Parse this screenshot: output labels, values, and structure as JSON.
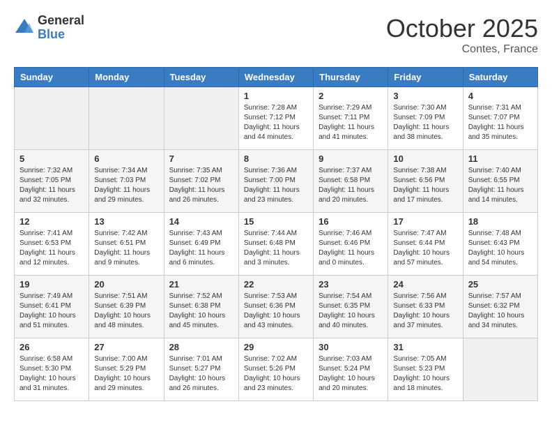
{
  "logo": {
    "general": "General",
    "blue": "Blue"
  },
  "title": {
    "month": "October 2025",
    "location": "Contes, France"
  },
  "headers": [
    "Sunday",
    "Monday",
    "Tuesday",
    "Wednesday",
    "Thursday",
    "Friday",
    "Saturday"
  ],
  "weeks": [
    [
      {
        "day": "",
        "info": ""
      },
      {
        "day": "",
        "info": ""
      },
      {
        "day": "",
        "info": ""
      },
      {
        "day": "1",
        "info": "Sunrise: 7:28 AM\nSunset: 7:12 PM\nDaylight: 11 hours and 44 minutes."
      },
      {
        "day": "2",
        "info": "Sunrise: 7:29 AM\nSunset: 7:11 PM\nDaylight: 11 hours and 41 minutes."
      },
      {
        "day": "3",
        "info": "Sunrise: 7:30 AM\nSunset: 7:09 PM\nDaylight: 11 hours and 38 minutes."
      },
      {
        "day": "4",
        "info": "Sunrise: 7:31 AM\nSunset: 7:07 PM\nDaylight: 11 hours and 35 minutes."
      }
    ],
    [
      {
        "day": "5",
        "info": "Sunrise: 7:32 AM\nSunset: 7:05 PM\nDaylight: 11 hours and 32 minutes."
      },
      {
        "day": "6",
        "info": "Sunrise: 7:34 AM\nSunset: 7:03 PM\nDaylight: 11 hours and 29 minutes."
      },
      {
        "day": "7",
        "info": "Sunrise: 7:35 AM\nSunset: 7:02 PM\nDaylight: 11 hours and 26 minutes."
      },
      {
        "day": "8",
        "info": "Sunrise: 7:36 AM\nSunset: 7:00 PM\nDaylight: 11 hours and 23 minutes."
      },
      {
        "day": "9",
        "info": "Sunrise: 7:37 AM\nSunset: 6:58 PM\nDaylight: 11 hours and 20 minutes."
      },
      {
        "day": "10",
        "info": "Sunrise: 7:38 AM\nSunset: 6:56 PM\nDaylight: 11 hours and 17 minutes."
      },
      {
        "day": "11",
        "info": "Sunrise: 7:40 AM\nSunset: 6:55 PM\nDaylight: 11 hours and 14 minutes."
      }
    ],
    [
      {
        "day": "12",
        "info": "Sunrise: 7:41 AM\nSunset: 6:53 PM\nDaylight: 11 hours and 12 minutes."
      },
      {
        "day": "13",
        "info": "Sunrise: 7:42 AM\nSunset: 6:51 PM\nDaylight: 11 hours and 9 minutes."
      },
      {
        "day": "14",
        "info": "Sunrise: 7:43 AM\nSunset: 6:49 PM\nDaylight: 11 hours and 6 minutes."
      },
      {
        "day": "15",
        "info": "Sunrise: 7:44 AM\nSunset: 6:48 PM\nDaylight: 11 hours and 3 minutes."
      },
      {
        "day": "16",
        "info": "Sunrise: 7:46 AM\nSunset: 6:46 PM\nDaylight: 11 hours and 0 minutes."
      },
      {
        "day": "17",
        "info": "Sunrise: 7:47 AM\nSunset: 6:44 PM\nDaylight: 10 hours and 57 minutes."
      },
      {
        "day": "18",
        "info": "Sunrise: 7:48 AM\nSunset: 6:43 PM\nDaylight: 10 hours and 54 minutes."
      }
    ],
    [
      {
        "day": "19",
        "info": "Sunrise: 7:49 AM\nSunset: 6:41 PM\nDaylight: 10 hours and 51 minutes."
      },
      {
        "day": "20",
        "info": "Sunrise: 7:51 AM\nSunset: 6:39 PM\nDaylight: 10 hours and 48 minutes."
      },
      {
        "day": "21",
        "info": "Sunrise: 7:52 AM\nSunset: 6:38 PM\nDaylight: 10 hours and 45 minutes."
      },
      {
        "day": "22",
        "info": "Sunrise: 7:53 AM\nSunset: 6:36 PM\nDaylight: 10 hours and 43 minutes."
      },
      {
        "day": "23",
        "info": "Sunrise: 7:54 AM\nSunset: 6:35 PM\nDaylight: 10 hours and 40 minutes."
      },
      {
        "day": "24",
        "info": "Sunrise: 7:56 AM\nSunset: 6:33 PM\nDaylight: 10 hours and 37 minutes."
      },
      {
        "day": "25",
        "info": "Sunrise: 7:57 AM\nSunset: 6:32 PM\nDaylight: 10 hours and 34 minutes."
      }
    ],
    [
      {
        "day": "26",
        "info": "Sunrise: 6:58 AM\nSunset: 5:30 PM\nDaylight: 10 hours and 31 minutes."
      },
      {
        "day": "27",
        "info": "Sunrise: 7:00 AM\nSunset: 5:29 PM\nDaylight: 10 hours and 29 minutes."
      },
      {
        "day": "28",
        "info": "Sunrise: 7:01 AM\nSunset: 5:27 PM\nDaylight: 10 hours and 26 minutes."
      },
      {
        "day": "29",
        "info": "Sunrise: 7:02 AM\nSunset: 5:26 PM\nDaylight: 10 hours and 23 minutes."
      },
      {
        "day": "30",
        "info": "Sunrise: 7:03 AM\nSunset: 5:24 PM\nDaylight: 10 hours and 20 minutes."
      },
      {
        "day": "31",
        "info": "Sunrise: 7:05 AM\nSunset: 5:23 PM\nDaylight: 10 hours and 18 minutes."
      },
      {
        "day": "",
        "info": ""
      }
    ]
  ]
}
